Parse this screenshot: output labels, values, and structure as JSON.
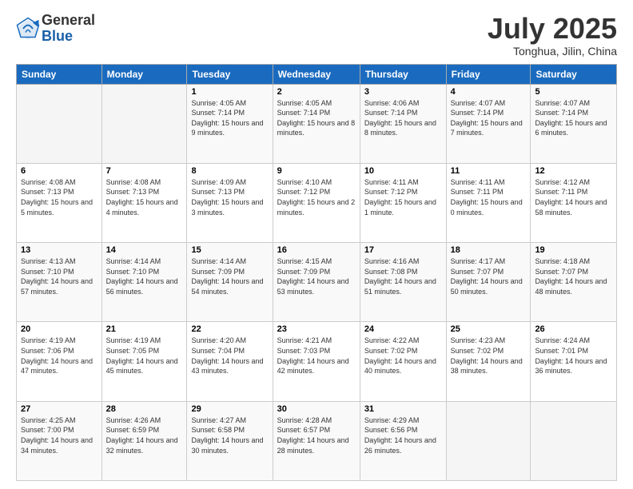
{
  "header": {
    "logo_general": "General",
    "logo_blue": "Blue",
    "month_title": "July 2025",
    "location": "Tonghua, Jilin, China"
  },
  "days_of_week": [
    "Sunday",
    "Monday",
    "Tuesday",
    "Wednesday",
    "Thursday",
    "Friday",
    "Saturday"
  ],
  "weeks": [
    [
      {
        "day": "",
        "empty": true
      },
      {
        "day": "",
        "empty": true
      },
      {
        "day": "1",
        "sunrise": "Sunrise: 4:05 AM",
        "sunset": "Sunset: 7:14 PM",
        "daylight": "Daylight: 15 hours and 9 minutes."
      },
      {
        "day": "2",
        "sunrise": "Sunrise: 4:05 AM",
        "sunset": "Sunset: 7:14 PM",
        "daylight": "Daylight: 15 hours and 8 minutes."
      },
      {
        "day": "3",
        "sunrise": "Sunrise: 4:06 AM",
        "sunset": "Sunset: 7:14 PM",
        "daylight": "Daylight: 15 hours and 8 minutes."
      },
      {
        "day": "4",
        "sunrise": "Sunrise: 4:07 AM",
        "sunset": "Sunset: 7:14 PM",
        "daylight": "Daylight: 15 hours and 7 minutes."
      },
      {
        "day": "5",
        "sunrise": "Sunrise: 4:07 AM",
        "sunset": "Sunset: 7:14 PM",
        "daylight": "Daylight: 15 hours and 6 minutes."
      }
    ],
    [
      {
        "day": "6",
        "sunrise": "Sunrise: 4:08 AM",
        "sunset": "Sunset: 7:13 PM",
        "daylight": "Daylight: 15 hours and 5 minutes."
      },
      {
        "day": "7",
        "sunrise": "Sunrise: 4:08 AM",
        "sunset": "Sunset: 7:13 PM",
        "daylight": "Daylight: 15 hours and 4 minutes."
      },
      {
        "day": "8",
        "sunrise": "Sunrise: 4:09 AM",
        "sunset": "Sunset: 7:13 PM",
        "daylight": "Daylight: 15 hours and 3 minutes."
      },
      {
        "day": "9",
        "sunrise": "Sunrise: 4:10 AM",
        "sunset": "Sunset: 7:12 PM",
        "daylight": "Daylight: 15 hours and 2 minutes."
      },
      {
        "day": "10",
        "sunrise": "Sunrise: 4:11 AM",
        "sunset": "Sunset: 7:12 PM",
        "daylight": "Daylight: 15 hours and 1 minute."
      },
      {
        "day": "11",
        "sunrise": "Sunrise: 4:11 AM",
        "sunset": "Sunset: 7:11 PM",
        "daylight": "Daylight: 15 hours and 0 minutes."
      },
      {
        "day": "12",
        "sunrise": "Sunrise: 4:12 AM",
        "sunset": "Sunset: 7:11 PM",
        "daylight": "Daylight: 14 hours and 58 minutes."
      }
    ],
    [
      {
        "day": "13",
        "sunrise": "Sunrise: 4:13 AM",
        "sunset": "Sunset: 7:10 PM",
        "daylight": "Daylight: 14 hours and 57 minutes."
      },
      {
        "day": "14",
        "sunrise": "Sunrise: 4:14 AM",
        "sunset": "Sunset: 7:10 PM",
        "daylight": "Daylight: 14 hours and 56 minutes."
      },
      {
        "day": "15",
        "sunrise": "Sunrise: 4:14 AM",
        "sunset": "Sunset: 7:09 PM",
        "daylight": "Daylight: 14 hours and 54 minutes."
      },
      {
        "day": "16",
        "sunrise": "Sunrise: 4:15 AM",
        "sunset": "Sunset: 7:09 PM",
        "daylight": "Daylight: 14 hours and 53 minutes."
      },
      {
        "day": "17",
        "sunrise": "Sunrise: 4:16 AM",
        "sunset": "Sunset: 7:08 PM",
        "daylight": "Daylight: 14 hours and 51 minutes."
      },
      {
        "day": "18",
        "sunrise": "Sunrise: 4:17 AM",
        "sunset": "Sunset: 7:07 PM",
        "daylight": "Daylight: 14 hours and 50 minutes."
      },
      {
        "day": "19",
        "sunrise": "Sunrise: 4:18 AM",
        "sunset": "Sunset: 7:07 PM",
        "daylight": "Daylight: 14 hours and 48 minutes."
      }
    ],
    [
      {
        "day": "20",
        "sunrise": "Sunrise: 4:19 AM",
        "sunset": "Sunset: 7:06 PM",
        "daylight": "Daylight: 14 hours and 47 minutes."
      },
      {
        "day": "21",
        "sunrise": "Sunrise: 4:19 AM",
        "sunset": "Sunset: 7:05 PM",
        "daylight": "Daylight: 14 hours and 45 minutes."
      },
      {
        "day": "22",
        "sunrise": "Sunrise: 4:20 AM",
        "sunset": "Sunset: 7:04 PM",
        "daylight": "Daylight: 14 hours and 43 minutes."
      },
      {
        "day": "23",
        "sunrise": "Sunrise: 4:21 AM",
        "sunset": "Sunset: 7:03 PM",
        "daylight": "Daylight: 14 hours and 42 minutes."
      },
      {
        "day": "24",
        "sunrise": "Sunrise: 4:22 AM",
        "sunset": "Sunset: 7:02 PM",
        "daylight": "Daylight: 14 hours and 40 minutes."
      },
      {
        "day": "25",
        "sunrise": "Sunrise: 4:23 AM",
        "sunset": "Sunset: 7:02 PM",
        "daylight": "Daylight: 14 hours and 38 minutes."
      },
      {
        "day": "26",
        "sunrise": "Sunrise: 4:24 AM",
        "sunset": "Sunset: 7:01 PM",
        "daylight": "Daylight: 14 hours and 36 minutes."
      }
    ],
    [
      {
        "day": "27",
        "sunrise": "Sunrise: 4:25 AM",
        "sunset": "Sunset: 7:00 PM",
        "daylight": "Daylight: 14 hours and 34 minutes."
      },
      {
        "day": "28",
        "sunrise": "Sunrise: 4:26 AM",
        "sunset": "Sunset: 6:59 PM",
        "daylight": "Daylight: 14 hours and 32 minutes."
      },
      {
        "day": "29",
        "sunrise": "Sunrise: 4:27 AM",
        "sunset": "Sunset: 6:58 PM",
        "daylight": "Daylight: 14 hours and 30 minutes."
      },
      {
        "day": "30",
        "sunrise": "Sunrise: 4:28 AM",
        "sunset": "Sunset: 6:57 PM",
        "daylight": "Daylight: 14 hours and 28 minutes."
      },
      {
        "day": "31",
        "sunrise": "Sunrise: 4:29 AM",
        "sunset": "Sunset: 6:56 PM",
        "daylight": "Daylight: 14 hours and 26 minutes."
      },
      {
        "day": "",
        "empty": true
      },
      {
        "day": "",
        "empty": true
      }
    ]
  ]
}
